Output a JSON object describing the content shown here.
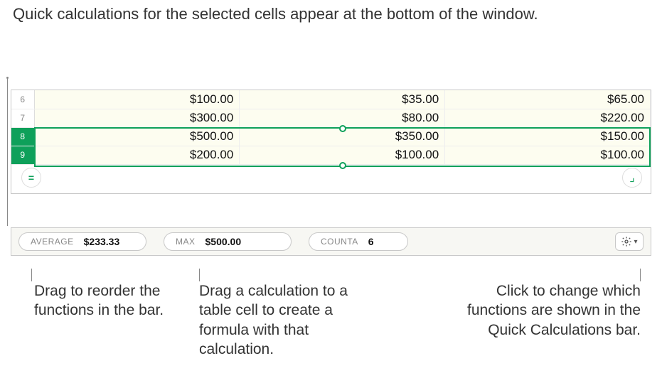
{
  "callouts": {
    "top": "Quick calculations for the selected cells appear at the bottom of the window.",
    "bottom1": "Drag to reorder the functions in the bar.",
    "bottom2": "Drag a calculation to a table cell to create a formula with that calculation.",
    "bottom3": "Click to change which functions are shown in the Quick Calculations bar."
  },
  "rows": [
    {
      "num": "6",
      "selected": false,
      "c1": "$100.00",
      "c2": "$35.00",
      "c3": "$65.00"
    },
    {
      "num": "7",
      "selected": false,
      "c1": "$300.00",
      "c2": "$80.00",
      "c3": "$220.00"
    },
    {
      "num": "8",
      "selected": true,
      "c1": "$500.00",
      "c2": "$350.00",
      "c3": "$150.00"
    },
    {
      "num": "9",
      "selected": true,
      "c1": "$200.00",
      "c2": "$100.00",
      "c3": "$100.00"
    }
  ],
  "quickcalc": {
    "pill1_fn": "AVERAGE",
    "pill1_val": "$233.33",
    "pill2_fn": "MAX",
    "pill2_val": "$500.00",
    "pill3_fn": "COUNTA",
    "pill3_val": "6"
  },
  "icons": {
    "row_add": "=",
    "corner": "⌟"
  }
}
